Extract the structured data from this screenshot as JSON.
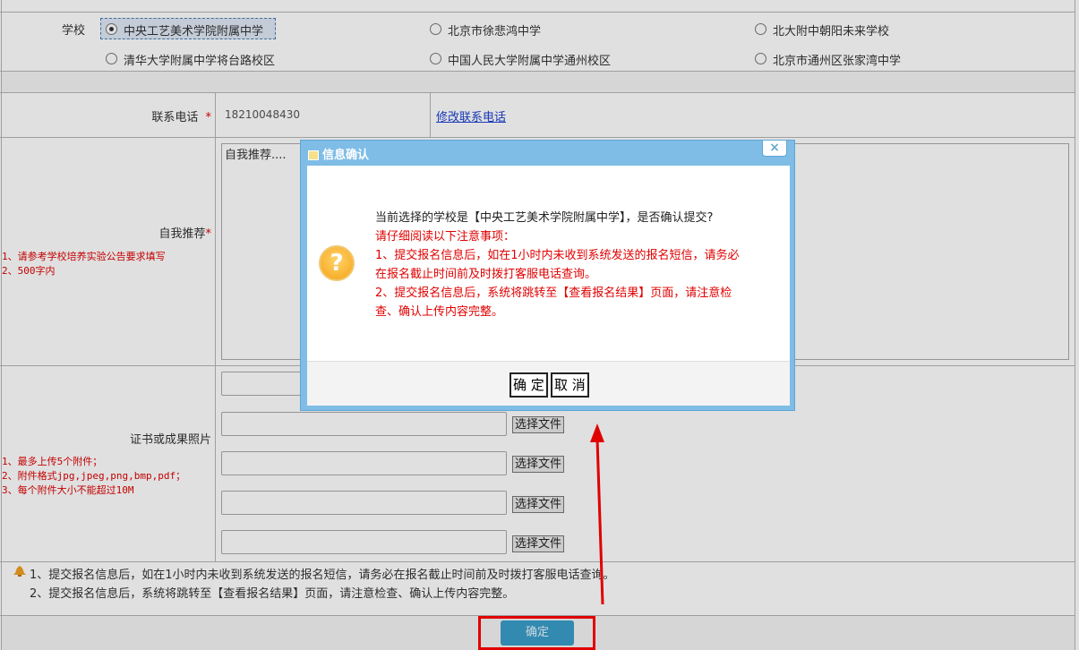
{
  "school": {
    "label": "学校",
    "options": [
      {
        "label": "中央工艺美术学院附属中学",
        "checked": true
      },
      {
        "label": "北京市徐悲鸿中学",
        "checked": false
      },
      {
        "label": "北大附中朝阳未来学校",
        "checked": false
      },
      {
        "label": "清华大学附属中学将台路校区",
        "checked": false
      },
      {
        "label": "中国人民大学附属中学通州校区",
        "checked": false
      },
      {
        "label": "北京市通州区张家湾中学",
        "checked": false
      }
    ]
  },
  "phone": {
    "label": "联系电话",
    "required_mark": "*",
    "value": "18210048430",
    "edit_link": "修改联系电话"
  },
  "self_intro": {
    "label": "自我推荐",
    "required_mark": "*",
    "hints": [
      "1、请参考学校培养实验公告要求填写",
      "2、500字内"
    ],
    "value": "自我推荐...."
  },
  "certificates": {
    "label": "证书或成果照片",
    "hints": [
      "1、最多上传5个附件；",
      "2、附件格式jpg,jpeg,png,bmp,pdf；",
      "3、每个附件大小不能超过10M"
    ],
    "choose_file_label": "选择文件"
  },
  "notice": {
    "line1": "1、提交报名信息后，如在1小时内未收到系统发送的报名短信，请务必在报名截止时间前及时拨打客服电话查询。",
    "line2": "2、提交报名信息后，系统将跳转至【查看报名结果】页面，请注意检查、确认上传内容完整。"
  },
  "submit_label": "确定",
  "dialog": {
    "title": "信息确认",
    "close": "×",
    "question": "当前选择的学校是【中央工艺美术学院附属中学】，是否确认提交?",
    "lines": [
      "请仔细阅读以下注意事项：",
      "1、提交报名信息后，如在1小时内未收到系统发送的报名短信，请务必",
      "在报名截止时间前及时拨打客服电话查询。",
      "2、提交报名信息后，系统将跳转至【查看报名结果】页面，请注意检",
      "查、确认上传内容完整。"
    ],
    "confirm": "确 定",
    "cancel": "取 消",
    "icon": "question-icon"
  },
  "colors": {
    "accent": "#3b9ec9",
    "warning": "#e00000",
    "dialog_frame": "#7fbde6"
  }
}
